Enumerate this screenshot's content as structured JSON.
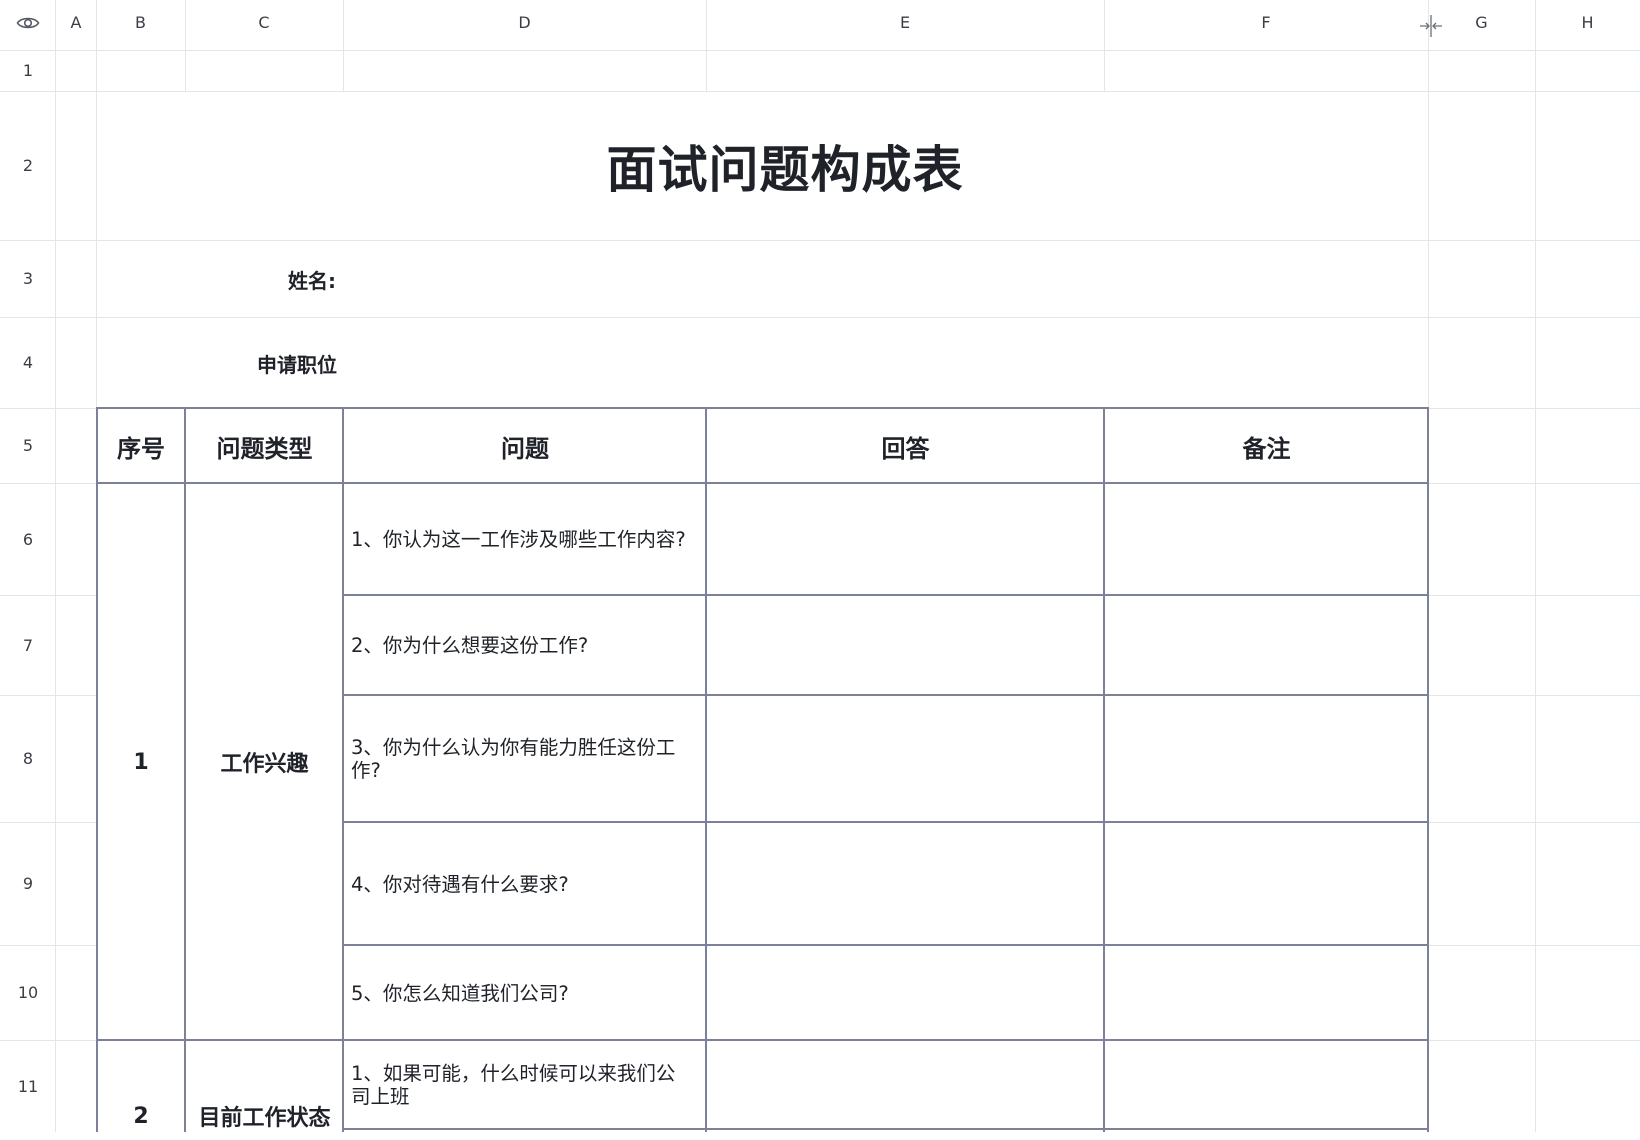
{
  "sheet": {
    "column_headers": [
      "A",
      "B",
      "C",
      "D",
      "E",
      "F",
      "G",
      "H"
    ],
    "row_headers": [
      "1",
      "2",
      "3",
      "4",
      "5",
      "6",
      "7",
      "8",
      "9",
      "10",
      "11"
    ],
    "icons": {
      "visibility": "eye-icon",
      "freeze": "freeze-columns-icon"
    }
  },
  "form": {
    "title": "面试问题构成表",
    "name_label": "姓名:",
    "position_label": "申请职位"
  },
  "table": {
    "headers": [
      "序号",
      "问题类型",
      "问题",
      "回答",
      "备注"
    ],
    "groups": [
      {
        "number": "1",
        "type": "工作兴趣",
        "questions": [
          "1、你认为这一工作涉及哪些工作内容?",
          "2、你为什么想要这份工作?",
          "3、你为什么认为你有能力胜任这份工作?",
          "4、你对待遇有什么要求?",
          "5、你怎么知道我们公司?"
        ]
      },
      {
        "number": "2",
        "type": "目前工作状态",
        "questions": [
          "1、如果可能，什么时候可以来我们公司上班"
        ]
      }
    ]
  },
  "colors": {
    "grid": "#e3e5e8",
    "table_border": "#7c8099",
    "text": "#1f2329"
  }
}
